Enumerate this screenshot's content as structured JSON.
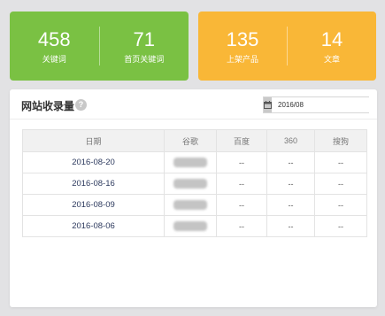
{
  "stats_left": [
    {
      "value": "458",
      "label": "关键词"
    },
    {
      "value": "71",
      "label": "首页关键词"
    }
  ],
  "stats_right": [
    {
      "value": "135",
      "label": "上架产品"
    },
    {
      "value": "14",
      "label": "文章"
    }
  ],
  "panel": {
    "title": "网站收录量",
    "help_icon_text": "?",
    "date_value": "2016/08"
  },
  "table": {
    "headers": [
      "日期",
      "谷歌",
      "百度",
      "360",
      "搜狗"
    ],
    "rows": [
      {
        "date": "2016-08-20",
        "baidu": "--",
        "s360": "--",
        "sogou": "--"
      },
      {
        "date": "2016-08-16",
        "baidu": "--",
        "s360": "--",
        "sogou": "--"
      },
      {
        "date": "2016-08-09",
        "baidu": "--",
        "s360": "--",
        "sogou": "--"
      },
      {
        "date": "2016-08-06",
        "baidu": "--",
        "s360": "--",
        "sogou": "--"
      }
    ]
  },
  "colors": {
    "green_card": "#7ac143",
    "orange_card": "#f9b737",
    "date_text": "#2d3a5e"
  },
  "icons": {
    "help": "help-icon",
    "calendar": "calendar-icon"
  }
}
